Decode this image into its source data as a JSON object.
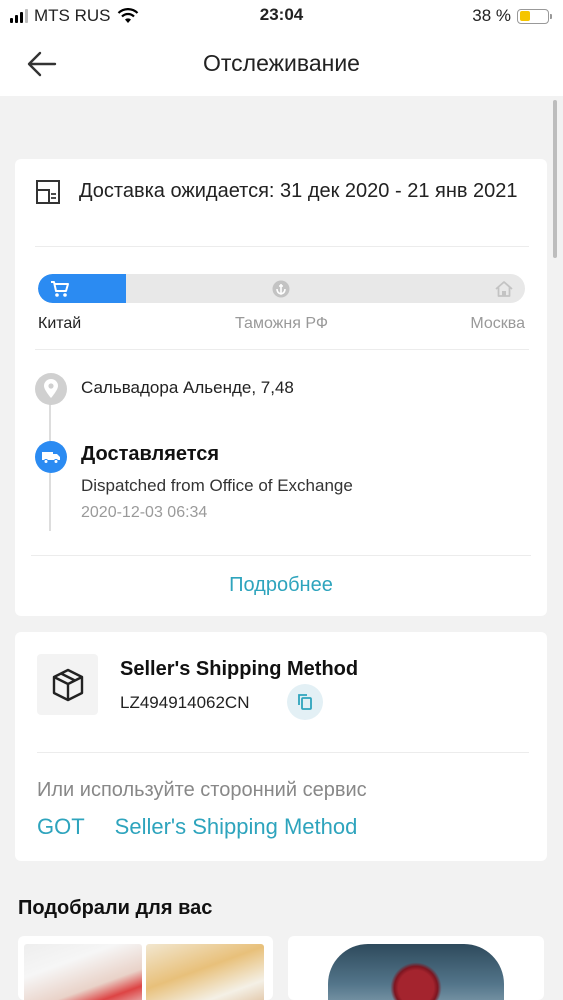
{
  "status_bar": {
    "carrier": "MTS RUS",
    "time": "23:04",
    "battery_percent": "38 %",
    "battery_level": 0.38
  },
  "header": {
    "title": "Отслеживание"
  },
  "delivery": {
    "text": "Доставка ожидается: 31 дек 2020 - 21 янв 2021"
  },
  "progress": {
    "level": 0.18,
    "steps": [
      "Китай",
      "Таможня РФ",
      "Москва"
    ]
  },
  "timeline": {
    "address": "Сальвадора Альенде, 7,48",
    "status": "Доставляется",
    "detail": "Dispatched from Office of Exchange",
    "time": "2020-12-03 06:34"
  },
  "more_link": "Подробнее",
  "shipping": {
    "method": "Seller's Shipping Method",
    "tracking_number": "LZ494914062CN",
    "alt_label": "Или используйте сторонний сервис",
    "alt_links": [
      "GOT",
      "Seller's Shipping Method"
    ]
  },
  "recommendations": {
    "title": "Подобрали для вас"
  },
  "colors": {
    "accent_blue": "#2b8bf2",
    "link_teal": "#2ea4bd",
    "battery_yellow": "#f5c500"
  },
  "icons": {
    "back": "arrow-left-icon",
    "delivery": "calendar-box-icon",
    "cart": "cart-icon",
    "customs": "anchor-icon",
    "home": "home-icon",
    "pin": "location-pin-icon",
    "truck": "truck-icon",
    "package": "package-icon",
    "copy": "copy-icon"
  }
}
